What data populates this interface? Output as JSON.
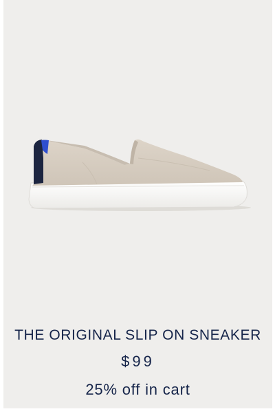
{
  "product": {
    "name": "THE ORIGINAL SLIP ON SNEAKER",
    "price": "$99",
    "promo": "25% off in cart",
    "image_icon": "slip-on-sneaker-image"
  },
  "colors": {
    "card_background": "#efeeec",
    "text": "#16254a",
    "knit": "#d8cfc3",
    "sole": "#ffffff",
    "heel_accent": "#2f4fcf"
  }
}
